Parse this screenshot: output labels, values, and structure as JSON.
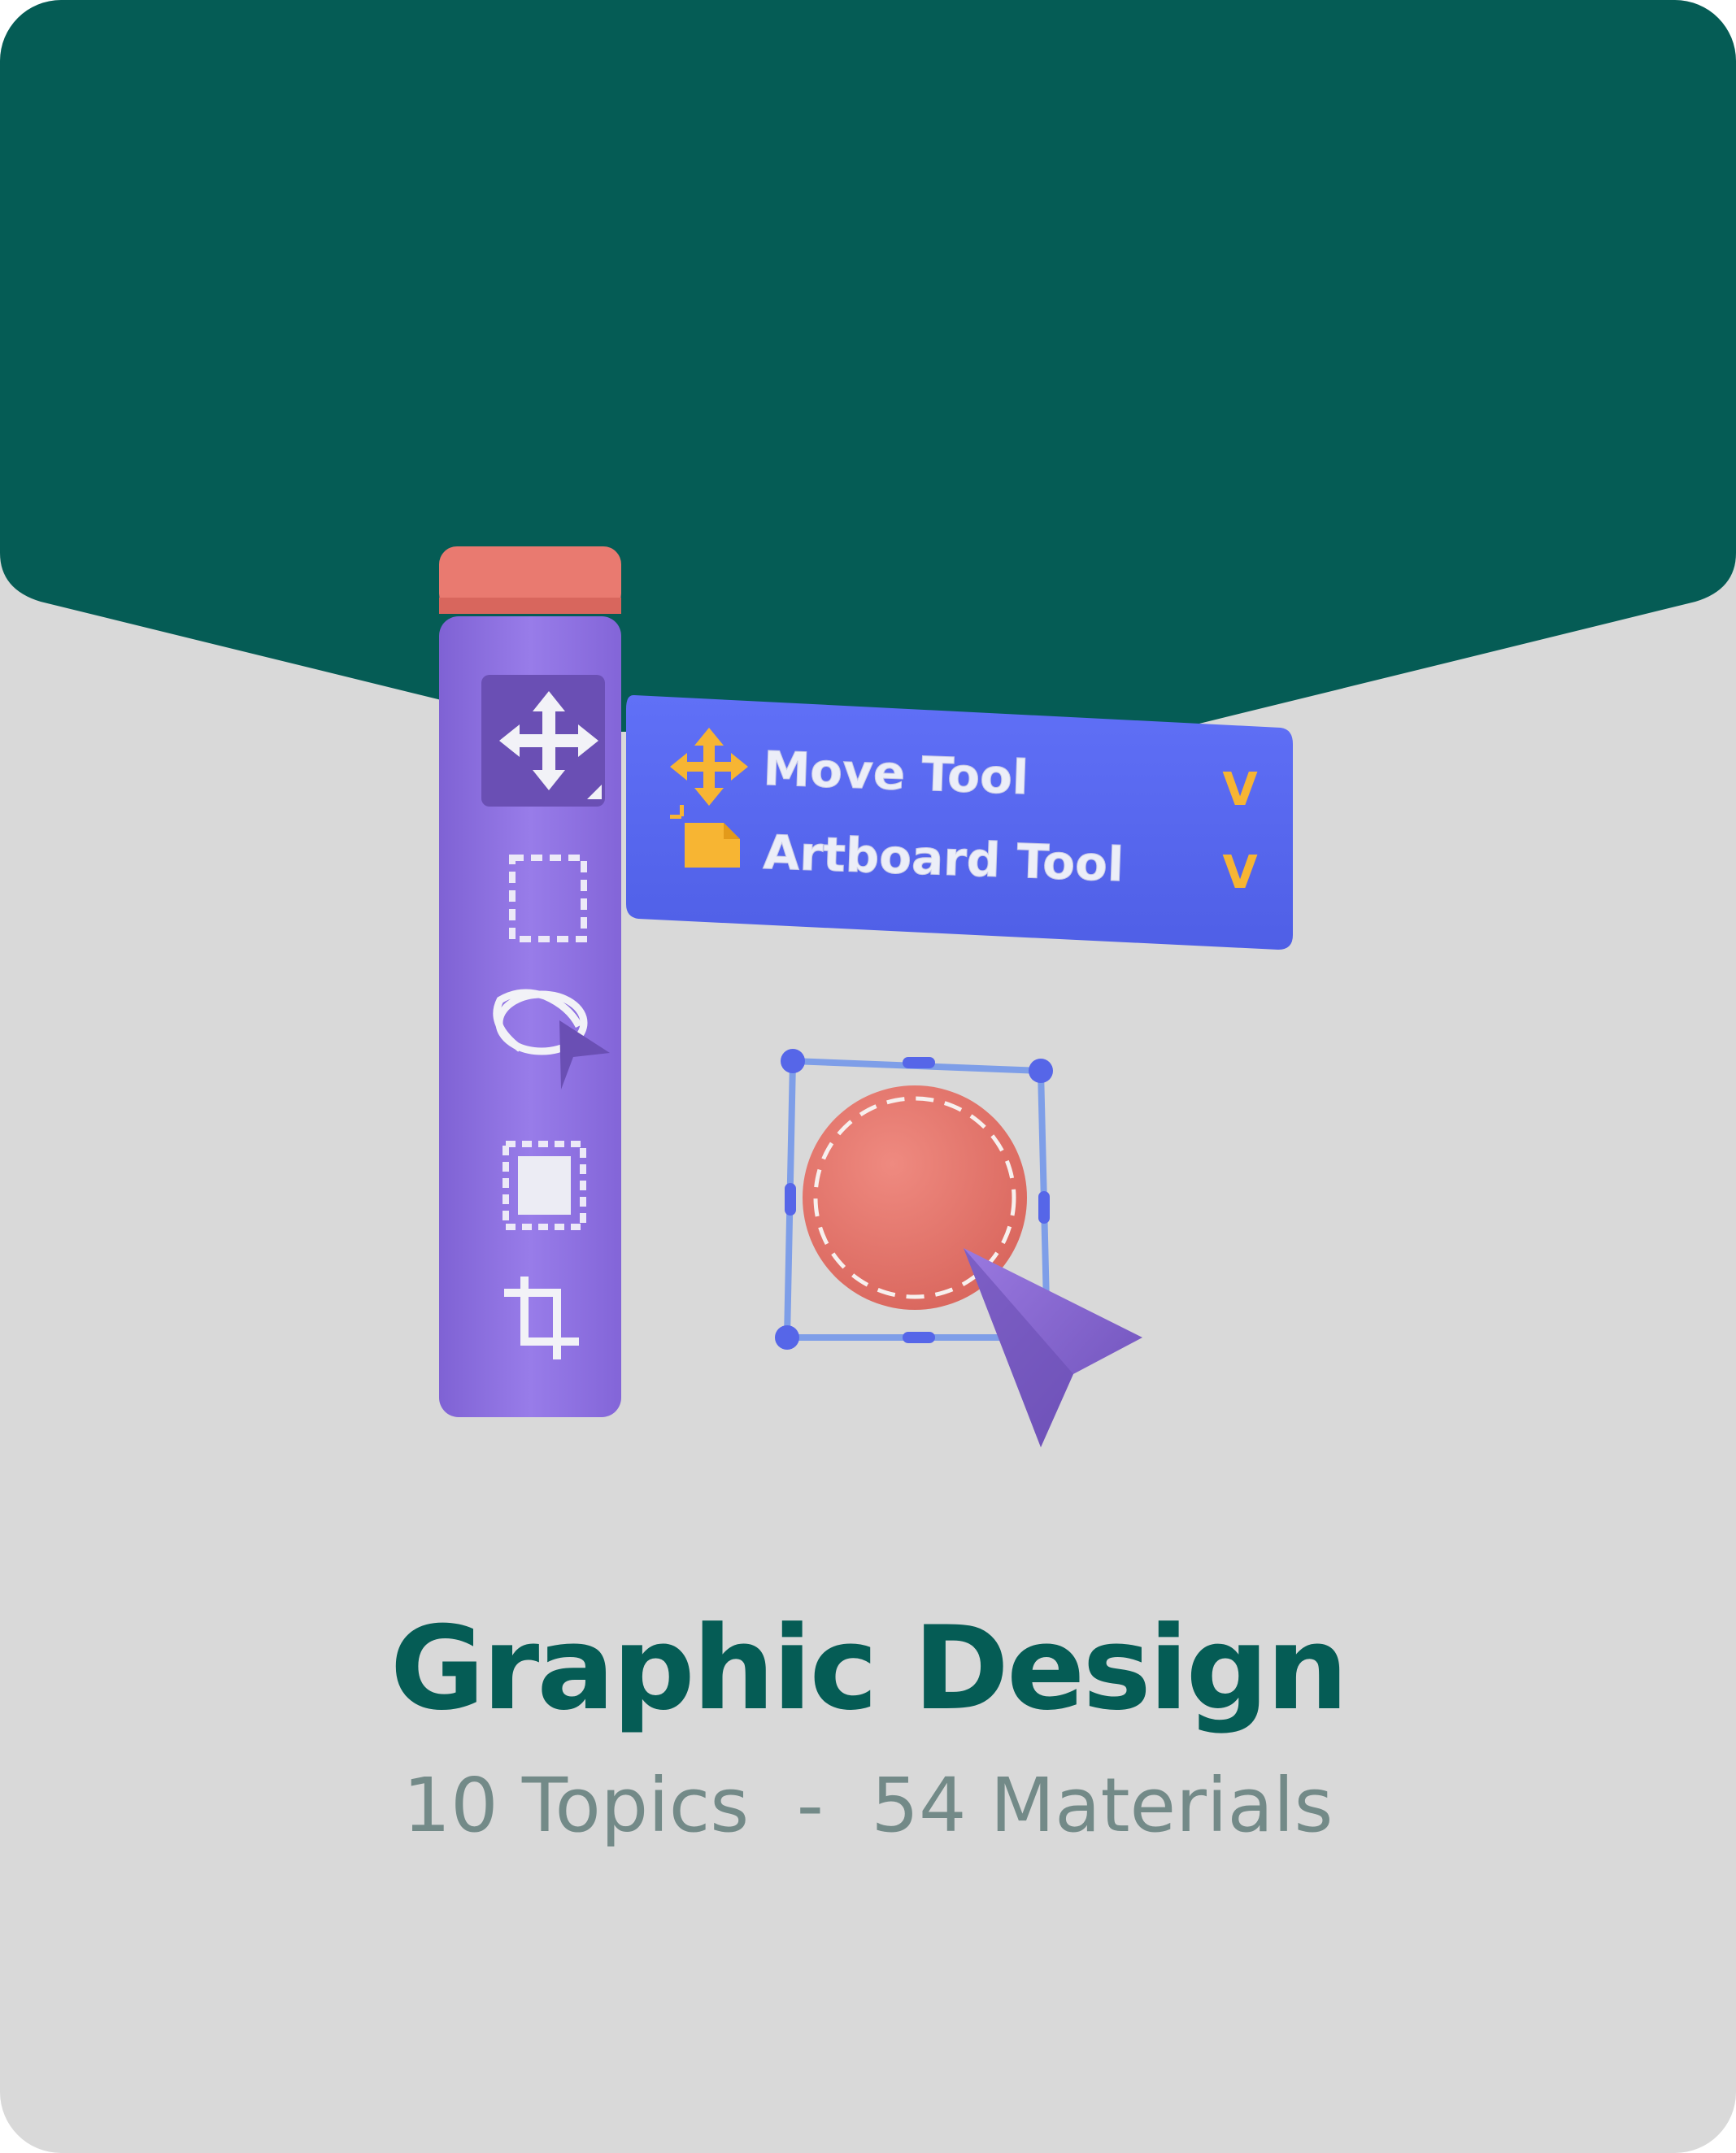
{
  "course": {
    "title": "Graphic Design",
    "topics": "10 Topics",
    "separator": "  -  ",
    "materials": "54 Materials"
  },
  "illustration": {
    "menu": {
      "items": [
        {
          "label": "Move Tool",
          "icon": "move-arrows-icon",
          "chevron": "V"
        },
        {
          "label": "Artboard Tool",
          "icon": "artboard-icon",
          "chevron": "V"
        }
      ]
    },
    "toolbar_icons": [
      "move-icon",
      "marquee-select-icon",
      "lasso-icon",
      "object-select-icon",
      "crop-icon"
    ]
  },
  "colors": {
    "banner": "#055c55",
    "background": "#d9d9d9",
    "toolbar": "#8f73e0",
    "menu": "#5b6bf2",
    "accent_red": "#e97a70",
    "accent_yellow": "#f7b533",
    "title": "#055c55",
    "meta": "#738a88"
  }
}
